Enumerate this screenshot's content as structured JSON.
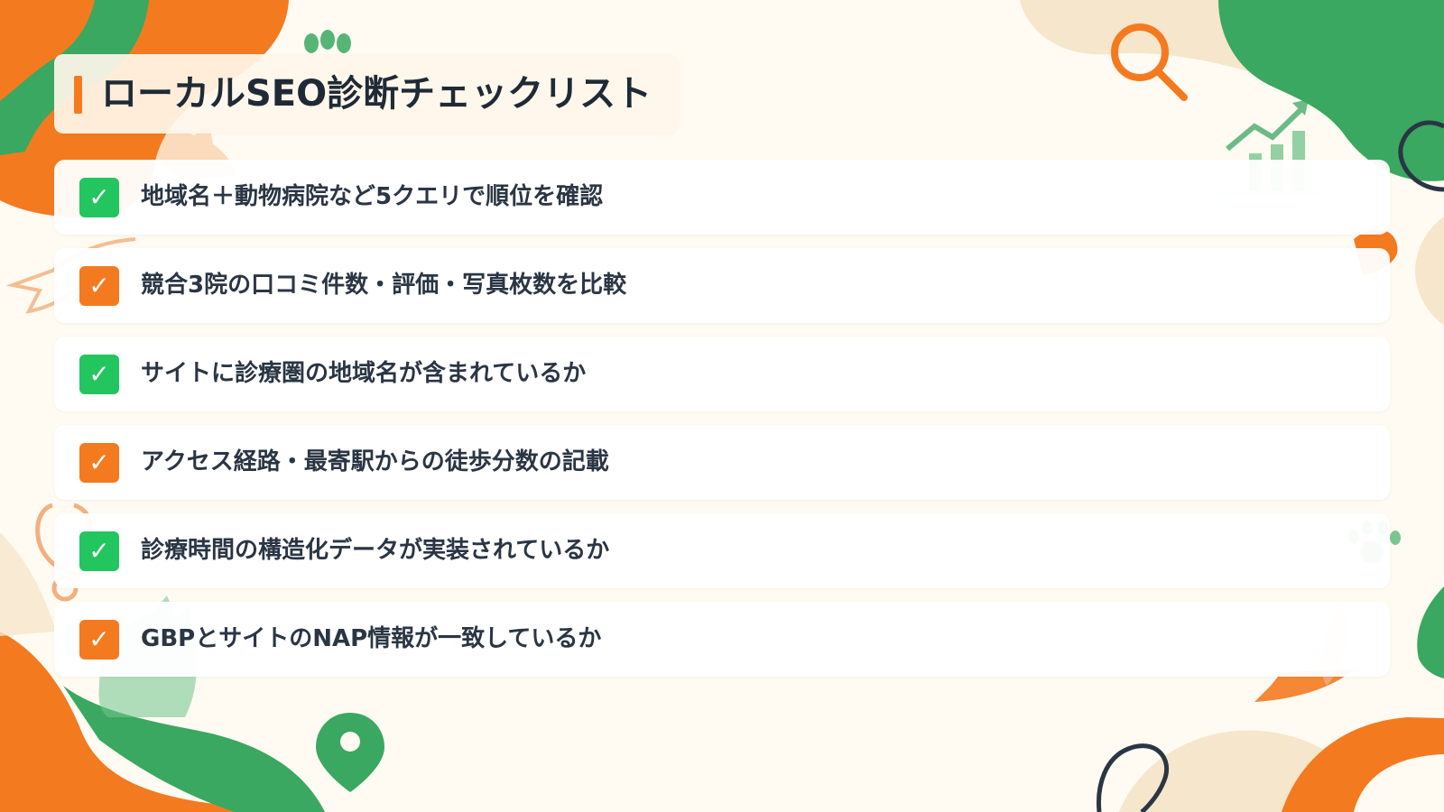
{
  "title": "ローカルSEO診断チェックリスト",
  "colors": {
    "accent_orange": "#f47a20",
    "accent_green": "#22c55e",
    "deco_green": "#3aa860",
    "background": "#fffbf2",
    "text": "#2a3644"
  },
  "check_glyph": "✓",
  "items": [
    {
      "text": "地域名＋動物病院など5クエリで順位を確認",
      "badge_color": "green"
    },
    {
      "text": "競合3院の口コミ件数・評価・写真枚数を比較",
      "badge_color": "orange"
    },
    {
      "text": "サイトに診療圏の地域名が含まれているか",
      "badge_color": "green"
    },
    {
      "text": "アクセス経路・最寄駅からの徒歩分数の記載",
      "badge_color": "orange"
    },
    {
      "text": "診療時間の構造化データが実装されているか",
      "badge_color": "green"
    },
    {
      "text": "GBPとサイトのNAP情報が一致しているか",
      "badge_color": "orange"
    }
  ],
  "decorations": [
    "paw-icon",
    "search-icon",
    "growth-chart-icon",
    "heart-icon",
    "cat-icon",
    "stethoscope-icon",
    "location-pin-icon",
    "paw-icon",
    "speech-bubble-icon"
  ]
}
